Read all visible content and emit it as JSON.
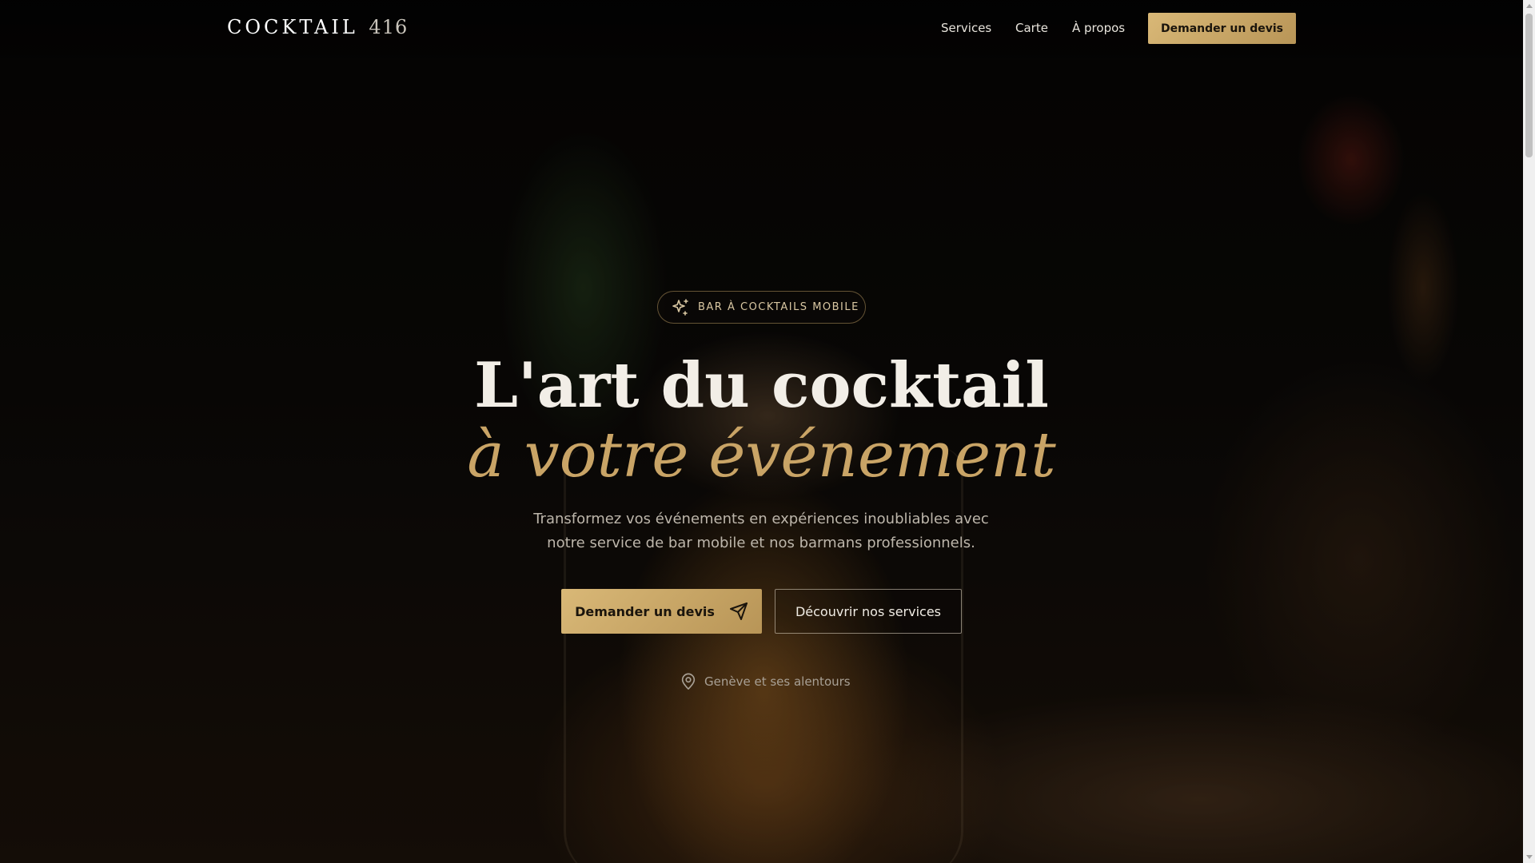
{
  "header": {
    "logo_word": "COCKTAIL",
    "logo_number": "416",
    "nav": {
      "services": "Services",
      "carte": "Carte",
      "apropos": "À propos"
    },
    "cta_label": "Demander un devis"
  },
  "hero": {
    "badge_icon": "sparkles-icon",
    "badge_label": "BAR À COCKTAILS MOBILE",
    "title_line1": "L'art du cocktail",
    "title_line2": "à votre événement",
    "subtitle": "Transformez vos événements en expériences inoubliables avec notre service de bar mobile et nos barmans professionnels.",
    "primary_cta": "Demander un devis",
    "primary_cta_icon": "send-icon",
    "secondary_cta": "Découvrir nos services",
    "location_icon": "map-pin-icon",
    "location": "Genève et ses alentours"
  },
  "colors": {
    "accent": "#c9a466",
    "button_gold": "#d9b877",
    "background": "#0a0806"
  }
}
